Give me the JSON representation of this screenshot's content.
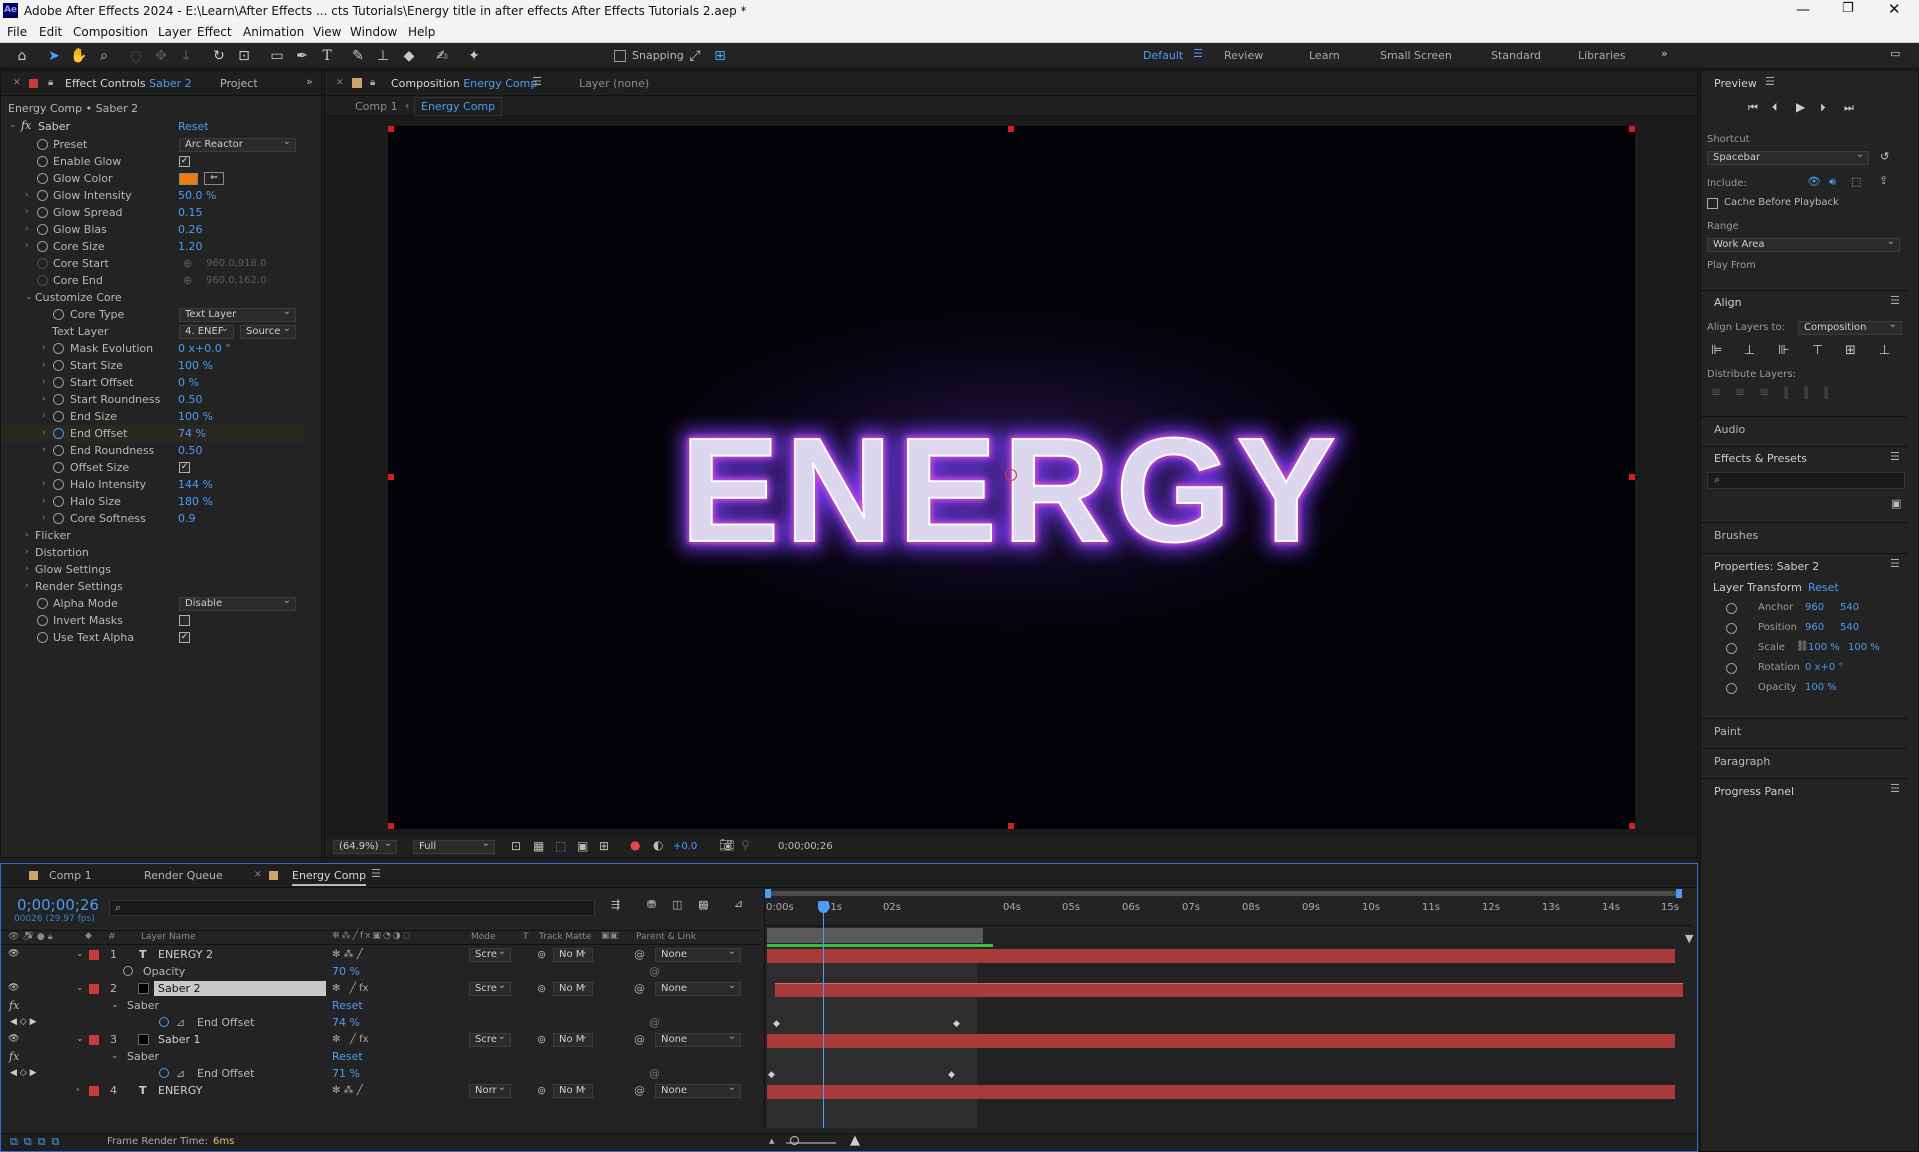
{
  "app": {
    "title": "Adobe After Effects 2024 - E:\\Learn\\After Effects ... cts Tutorials\\Energy title in after effects After Effects Tutorials 2.aep *",
    "logo": "Ae"
  },
  "menu": [
    "File",
    "Edit",
    "Composition",
    "Layer",
    "Effect",
    "Animation",
    "View",
    "Window",
    "Help"
  ],
  "toolbar": {
    "snapping_label": "Snapping",
    "workspaces": [
      "Default",
      "Review",
      "Learn",
      "Small Screen",
      "Standard",
      "Libraries"
    ],
    "active_workspace": "Default"
  },
  "left_panel": {
    "tab_effect_controls": "Effect Controls",
    "tab_effect_layer": "Saber 2",
    "tab_project": "Project",
    "breadcrumb": "Energy Comp • Saber 2",
    "effect_name": "Saber",
    "reset": "Reset",
    "rows": [
      {
        "name": "Preset",
        "kind": "dropdown",
        "value": "Arc Reactor"
      },
      {
        "name": "Enable Glow",
        "kind": "check",
        "value": "✓"
      },
      {
        "name": "Glow Color",
        "kind": "color",
        "value": ""
      },
      {
        "name": "Glow Intensity",
        "kind": "num",
        "value": "50.0 %"
      },
      {
        "name": "Glow Spread",
        "kind": "num",
        "value": "0.15"
      },
      {
        "name": "Glow Bias",
        "kind": "num",
        "value": "0.26"
      },
      {
        "name": "Core Size",
        "kind": "num",
        "value": "1.20"
      },
      {
        "name": "Core Start",
        "kind": "dis",
        "value": "960.0,918.0"
      },
      {
        "name": "Core End",
        "kind": "dis",
        "value": "960.0,162.0"
      }
    ],
    "customize_core": "Customize Core",
    "core_type_label": "Core Type",
    "core_type_value": "Text Layer",
    "text_layer_label": "Text Layer",
    "text_layer_value": "4. ENEF",
    "text_layer_source": "Source",
    "core_rows": [
      {
        "name": "Mask Evolution",
        "value": "0 x+0.0 °"
      },
      {
        "name": "Start Size",
        "value": "100 %"
      },
      {
        "name": "Start Offset",
        "value": "0 %"
      },
      {
        "name": "Start Roundness",
        "value": "0.50"
      },
      {
        "name": "End Size",
        "value": "100 %"
      },
      {
        "name": "End Offset",
        "value": "74 %"
      },
      {
        "name": "End Roundness",
        "value": "0.50"
      },
      {
        "name": "Offset Size",
        "value": "✓"
      },
      {
        "name": "Halo Intensity",
        "value": "144 %"
      },
      {
        "name": "Halo Size",
        "value": "180 %"
      },
      {
        "name": "Core Softness",
        "value": "0.9"
      }
    ],
    "groups": [
      "Flicker",
      "Distortion",
      "Glow Settings",
      "Render Settings"
    ],
    "alpha_mode_label": "Alpha Mode",
    "alpha_mode_value": "Disable",
    "invert_masks": "Invert Masks",
    "use_text_alpha": "Use Text Alpha",
    "use_text_alpha_check": "✓"
  },
  "composition": {
    "tab_label": "Composition",
    "tab_name": "Energy Comp",
    "layer_tab": "Layer (none)",
    "crumb_1": "Comp 1",
    "crumb_2": "Energy Comp",
    "title_text": "ENERGY",
    "zoom": "(64.9%)",
    "resolution": "Full",
    "exposure": "+0.0",
    "timecode": "0;00;00;26"
  },
  "timeline": {
    "tabs": [
      "Comp 1",
      "Render Queue",
      "Energy Comp"
    ],
    "timecode": "0;00;00;26",
    "frame_info": "00026 (29.97 fps)",
    "col_headers": {
      "layer_name": "Layer Name",
      "mode": "Mode",
      "t": "T",
      "track_matte": "Track Matte",
      "parent": "Parent & Link"
    },
    "ruler": [
      "0:00s",
      "01s",
      "02s",
      "04s",
      "05s",
      "06s",
      "07s",
      "08s",
      "09s",
      "10s",
      "11s",
      "12s",
      "13s",
      "14s",
      "15s"
    ],
    "layers": [
      {
        "num": "1",
        "type": "T",
        "name": "ENERGY 2",
        "mode": "Scre",
        "matte": "No M",
        "parent": "None"
      },
      {
        "num": "2",
        "type": "",
        "name": "Saber 2",
        "mode": "Scre",
        "matte": "No M",
        "parent": "None"
      },
      {
        "num": "3",
        "type": "",
        "name": "Saber 1",
        "mode": "Scre",
        "matte": "No M",
        "parent": "None"
      },
      {
        "num": "4",
        "type": "T",
        "name": "ENERGY",
        "mode": "Norr",
        "matte": "No M",
        "parent": "None"
      }
    ],
    "opacity_label": "Opacity",
    "opacity_value": "70 %",
    "saber_label": "Saber",
    "reset_label": "Reset",
    "end_offset_label": "End Offset",
    "end_offset_1": "74 %",
    "end_offset_2": "71 %",
    "frame_render_label": "Frame Render Time:",
    "frame_render_value": "6ms"
  },
  "right_panel": {
    "preview_title": "Preview",
    "shortcut_label": "Shortcut",
    "shortcut_value": "Spacebar",
    "include_label": "Include:",
    "cache_label": "Cache Before Playback",
    "range_label": "Range",
    "range_value": "Work Area",
    "play_from_label": "Play From",
    "align_title": "Align",
    "align_to_label": "Align Layers to:",
    "align_to_value": "Composition",
    "distribute_label": "Distribute Layers:",
    "audio": "Audio",
    "effects_presets": "Effects & Presets",
    "brushes": "Brushes",
    "properties_title": "Properties: Saber 2",
    "layer_transform": "Layer Transform",
    "reset": "Reset",
    "anchor_label": "Anchor",
    "anchor_x": "960",
    "anchor_y": "540",
    "position_label": "Position",
    "position_x": "960",
    "position_y": "540",
    "scale_label": "Scale",
    "scale_x": "100 %",
    "scale_y": "100 %",
    "rotation_label": "Rotation",
    "rotation_value": "0 x+0 °",
    "opacity_label": "Opacity",
    "opacity_value": "100 %",
    "paint": "Paint",
    "paragraph": "Paragraph",
    "progress_panel": "Progress Panel"
  },
  "colors": {
    "accent": "#4a9cf5",
    "glow_color": "#f07b0c",
    "layer_bar": "#a83a3a",
    "label_red": "#c83a3a"
  }
}
